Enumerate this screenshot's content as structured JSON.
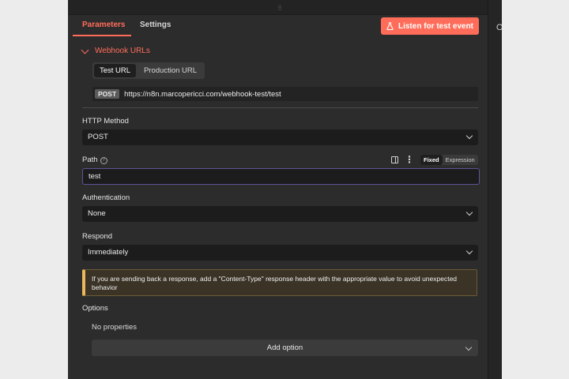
{
  "tabs": [
    {
      "label": "Parameters",
      "active": true
    },
    {
      "label": "Settings",
      "active": false
    }
  ],
  "listen_button": {
    "label": "Listen for test event",
    "icon": "flask-icon",
    "color": "#ff6d5a"
  },
  "webhook_urls": {
    "title": "Webhook URLs",
    "options": [
      "Test URL",
      "Production URL"
    ],
    "selected": "Test URL",
    "method_badge": "POST",
    "url": "https://n8n.marcopericci.com/webhook-test/test"
  },
  "http_method": {
    "label": "HTTP Method",
    "value": "POST"
  },
  "path": {
    "label": "Path",
    "help_icon": "help-circle-icon",
    "value": "test",
    "mode_fixed": "Fixed",
    "mode_expression": "Expression"
  },
  "authentication": {
    "label": "Authentication",
    "value": "None"
  },
  "respond": {
    "label": "Respond",
    "value": "Immediately"
  },
  "notice": "If you are sending back a response, add a \"Content-Type\" response header with the appropriate value to avoid unexpected behavior",
  "options": {
    "label": "Options",
    "empty_text": "No properties",
    "add_label": "Add option"
  },
  "right_panel": {
    "cut_text": "O"
  },
  "colors": {
    "accent": "#ff6d5a",
    "panel": "#2c2c2c",
    "notice_border": "#e8b85a"
  }
}
